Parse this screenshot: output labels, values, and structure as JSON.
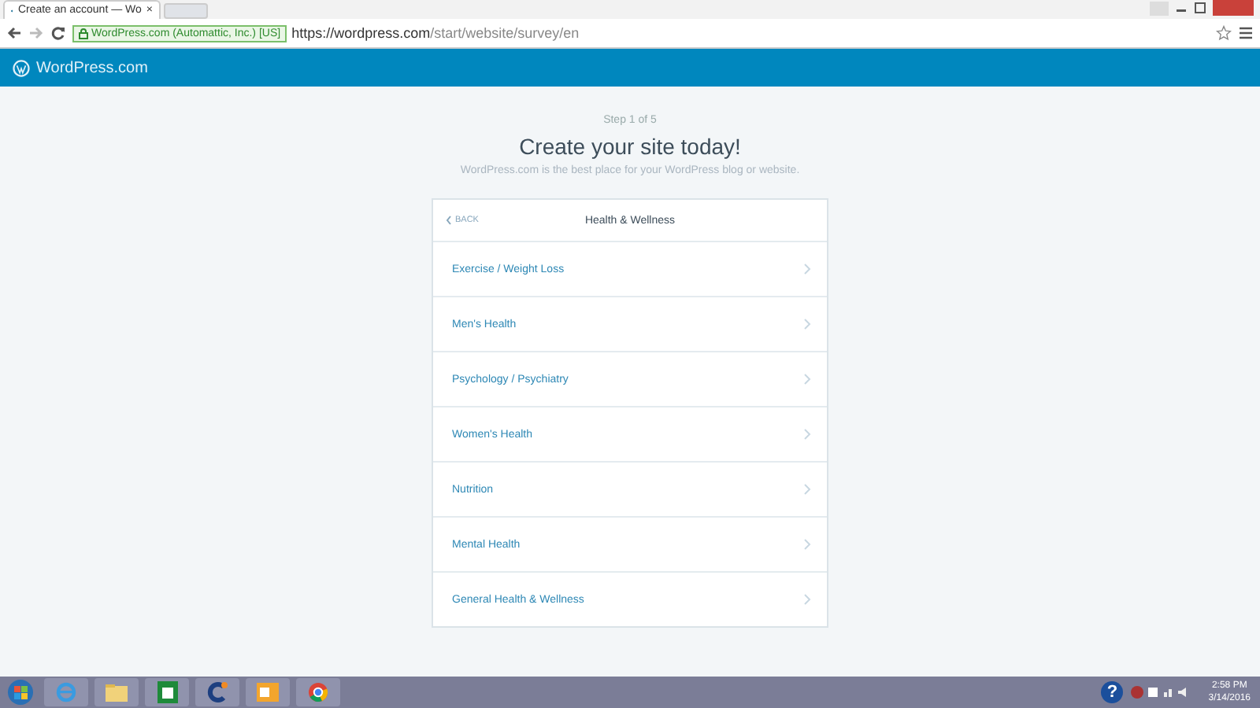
{
  "browser": {
    "tab_title": "Create an account — Wo",
    "tab_close": "×",
    "ev_badge": "WordPress.com (Automattic, Inc.) [US]",
    "url_host": "https://wordpress.com",
    "url_path": "/start/website/survey/en"
  },
  "header": {
    "logo_text": "WordPress.com"
  },
  "intro": {
    "step": "Step 1 of 5",
    "title": "Create your site today!",
    "subtitle": "WordPress.com is the best place for your WordPress blog or website."
  },
  "card": {
    "back": "BACK",
    "title": "Health & Wellness",
    "items": [
      {
        "label": "Exercise / Weight Loss"
      },
      {
        "label": "Men's Health"
      },
      {
        "label": "Psychology / Psychiatry"
      },
      {
        "label": "Women's Health"
      },
      {
        "label": "Nutrition"
      },
      {
        "label": "Mental Health"
      },
      {
        "label": "General Health & Wellness"
      }
    ]
  },
  "taskbar": {
    "help": "?",
    "time": "2:58 PM",
    "date": "3/14/2016"
  }
}
